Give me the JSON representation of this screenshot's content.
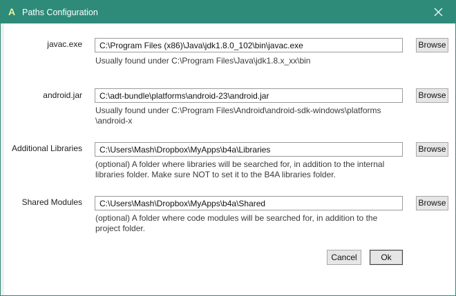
{
  "window": {
    "title": "Paths Configuration",
    "app_icon_glyph": "A",
    "accent_color": "#2e8b7a"
  },
  "fields": [
    {
      "label": "javac.exe",
      "value": "C:\\Program Files (x86)\\Java\\jdk1.8.0_102\\bin\\javac.exe",
      "hint": "Usually found under C:\\Program Files\\Java\\jdk1.8.x_xx\\bin",
      "browse_label": "Browse"
    },
    {
      "label": "android.jar",
      "value": "C:\\adt-bundle\\platforms\\android-23\\android.jar",
      "hint_line1": "Usually found under C:\\Program Files\\Android\\android-sdk-windows\\platforms",
      "hint_line2": "\\android-x",
      "browse_label": "Browse"
    },
    {
      "label": "Additional Libraries",
      "value": "C:\\Users\\Mash\\Dropbox\\MyApps\\b4a\\Libraries",
      "hint_line1": "(optional) A folder where libraries will be searched for, in addition to the internal",
      "hint_line2": "libraries folder. Make sure NOT to set it to the B4A libraries folder.",
      "browse_label": "Browse"
    },
    {
      "label": "Shared Modules",
      "value": "C:\\Users\\Mash\\Dropbox\\MyApps\\b4a\\Shared",
      "hint_line1": "(optional) A folder where code modules will be searched for, in addition to the",
      "hint_line2": "project folder.",
      "browse_label": "Browse"
    }
  ],
  "buttons": {
    "cancel_label": "Cancel",
    "ok_label": "Ok"
  },
  "icons": {
    "close": "close-icon",
    "app": "app-logo-icon"
  }
}
